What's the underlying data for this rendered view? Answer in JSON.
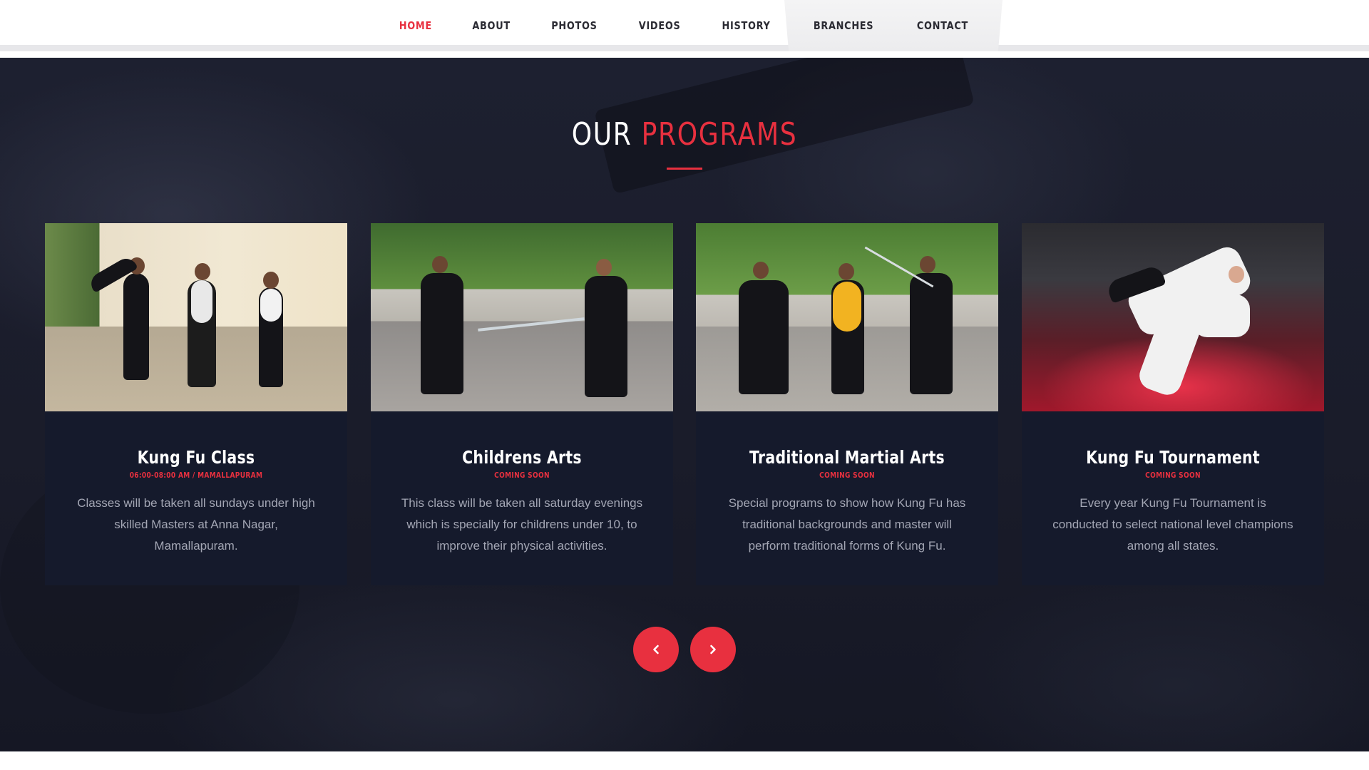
{
  "nav": {
    "items": [
      {
        "label": "HOME",
        "active": true
      },
      {
        "label": "ABOUT",
        "active": false
      },
      {
        "label": "PHOTOS",
        "active": false
      },
      {
        "label": "VIDEOS",
        "active": false
      },
      {
        "label": "HISTORY",
        "active": false
      },
      {
        "label": "BRANCHES",
        "active": false
      },
      {
        "label": "CONTACT",
        "active": false
      }
    ]
  },
  "section": {
    "title_part1": "OUR",
    "title_part2": "PROGRAMS"
  },
  "cards": [
    {
      "title": "Kung Fu Class",
      "subtitle": "06:00-08:00 AM / MAMALLAPURAM",
      "description": "Classes will be taken all sundays under high skilled Masters at Anna Nagar, Mamallapuram."
    },
    {
      "title": "Childrens Arts",
      "subtitle": "COMING SOON",
      "description": "This class will be taken all saturday evenings which is specially for childrens under 10, to improve their physical activities."
    },
    {
      "title": "Traditional Martial Arts",
      "subtitle": "COMING SOON",
      "description": "Special programs to show how Kung Fu has traditional backgrounds and master will perform traditional forms of Kung Fu."
    },
    {
      "title": "Kung Fu Tournament",
      "subtitle": "COMING SOON",
      "description": "Every year Kung Fu Tournament is conducted to select national level champions among all states."
    }
  ],
  "carousel": {
    "prev_icon": "chevron-left-icon",
    "next_icon": "chevron-right-icon"
  },
  "colors": {
    "accent": "#e8303f",
    "section_bg": "#1a1c2a",
    "card_bg": "#151a2c",
    "text_muted": "#a3a6b4"
  }
}
